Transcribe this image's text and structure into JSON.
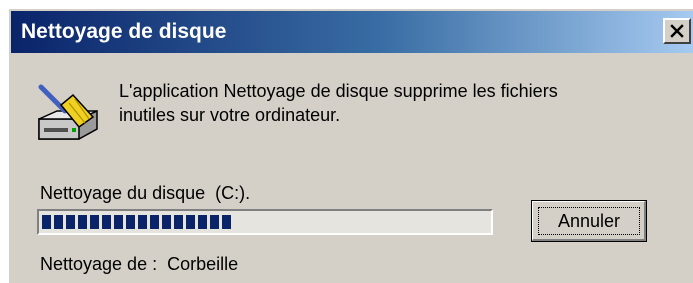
{
  "window": {
    "title": "Nettoyage de disque"
  },
  "message": {
    "text": "L'application Nettoyage de disque supprime les fichiers\ninutiles sur votre ordinateur."
  },
  "progress": {
    "drive_label": "Nettoyage du disque  (C:).",
    "fraction": 0.43
  },
  "status": {
    "text": "Nettoyage de :  Corbeille"
  },
  "buttons": {
    "cancel": "Annuler"
  },
  "icons": {
    "close": "close-icon",
    "app": "disk-cleanup-broom-icon"
  },
  "colors": {
    "title_start": "#0a246a",
    "title_end": "#a6caf0",
    "face": "#d4d0c8",
    "progress_blocks": "#0a246a"
  }
}
